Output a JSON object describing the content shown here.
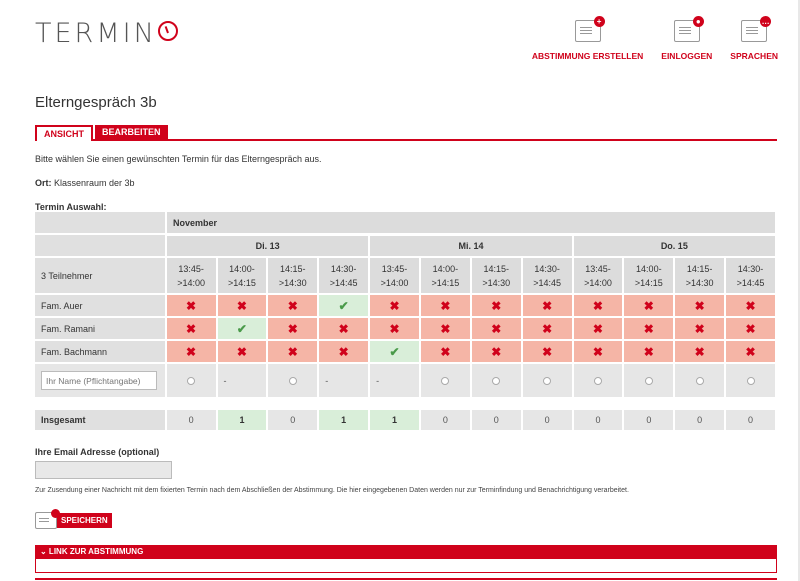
{
  "header": {
    "logo_text": "TERMIN",
    "logo_suffix": "O",
    "nav": [
      {
        "label": "ABSTIMMUNG ERSTELLEN",
        "icon": "new-poll-icon",
        "badge": "+"
      },
      {
        "label": "EINLOGGEN",
        "icon": "login-icon",
        "badge": "●"
      },
      {
        "label": "SPRACHEN",
        "icon": "languages-icon",
        "badge": "…"
      }
    ]
  },
  "page": {
    "title": "Elterngespräch 3b",
    "tabs": [
      {
        "label": "ANSICHT",
        "active": true
      },
      {
        "label": "BEARBEITEN",
        "active": false
      }
    ],
    "intro": "Bitte wählen Sie einen gewünschten Termin für das Elterngespräch aus.",
    "ort_label": "Ort:",
    "ort_value": "Klassenraum der 3b",
    "auswahl_label": "Termin Auswahl:"
  },
  "grid": {
    "month": "November",
    "days": [
      "Di. 13",
      "Mi. 14",
      "Do. 15"
    ],
    "participants_label": "3 Teilnehmer",
    "slots": [
      [
        "13:45-",
        ">14:00"
      ],
      [
        "14:00-",
        ">14:15"
      ],
      [
        "14:15-",
        ">14:30"
      ],
      [
        "14:30-",
        ">14:45"
      ],
      [
        "13:45-",
        ">14:00"
      ],
      [
        "14:00-",
        ">14:15"
      ],
      [
        "14:15-",
        ">14:30"
      ],
      [
        "14:30-",
        ">14:45"
      ],
      [
        "13:45-",
        ">14:00"
      ],
      [
        "14:00-",
        ">14:15"
      ],
      [
        "14:15-",
        ">14:30"
      ],
      [
        "14:30-",
        ">14:45"
      ]
    ],
    "rows": [
      {
        "name": "Fam. Auer",
        "votes": [
          "no",
          "no",
          "no",
          "yes",
          "no",
          "no",
          "no",
          "no",
          "no",
          "no",
          "no",
          "no"
        ]
      },
      {
        "name": "Fam. Ramani",
        "votes": [
          "no",
          "yes",
          "no",
          "no",
          "no",
          "no",
          "no",
          "no",
          "no",
          "no",
          "no",
          "no"
        ]
      },
      {
        "name": "Fam. Bachmann",
        "votes": [
          "no",
          "no",
          "no",
          "no",
          "yes",
          "no",
          "no",
          "no",
          "no",
          "no",
          "no",
          "no"
        ]
      }
    ],
    "new_row": {
      "placeholder": "Ihr Name (Pflichtangabe)",
      "cells": [
        "radio",
        "dash",
        "radio",
        "dash",
        "dash",
        "radio",
        "radio",
        "radio",
        "radio",
        "radio",
        "radio",
        "radio"
      ],
      "dash_text": "-"
    },
    "total_label": "Insgesamt",
    "totals": [
      "0",
      "1",
      "0",
      "1",
      "1",
      "0",
      "0",
      "0",
      "0",
      "0",
      "0",
      "0"
    ],
    "symbols": {
      "yes": "✔",
      "no": "✖"
    }
  },
  "email": {
    "label": "Ihre Email Adresse (optional)",
    "value": "",
    "note": "Zur Zusendung einer Nachricht mit dem fixierten Termin nach dem Abschließen der Abstimmung. Die hier eingegebenen Daten werden nur zur Terminfindung und Benachrichtigung verarbeitet."
  },
  "save_label": "SPEICHERN",
  "link_label": "⌄ LINK ZUR ABSTIMMUNG",
  "colors": {
    "accent": "#d0021b",
    "no_bg": "#f5b5a6",
    "yes_bg": "#d9eed9"
  }
}
